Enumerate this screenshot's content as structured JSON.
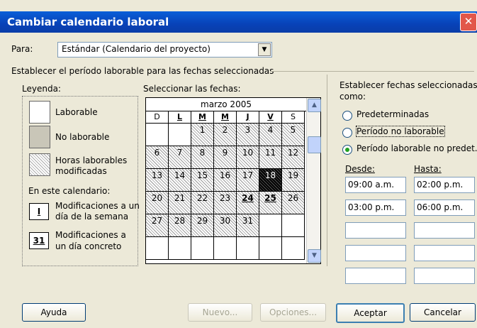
{
  "window": {
    "title": "Cambiar calendario laboral",
    "close_glyph": "✕"
  },
  "para": {
    "label": "Para:",
    "value": "Estándar (Calendario del proyecto)",
    "arrow": "▼"
  },
  "group_title": "Establecer el período laborable para las fechas seleccionadas",
  "legend": {
    "title": "Leyenda:",
    "items": [
      "Laborable",
      "No laborable",
      "Horas laborables",
      "modificadas"
    ],
    "subtitle": "En este calendario:",
    "icon1": "I",
    "icon1_label": [
      "Modificaciones a un",
      "día de la semana"
    ],
    "icon2": "31",
    "icon2_label": [
      "Modificaciones a",
      "un día concreto"
    ]
  },
  "calendar": {
    "label": "Seleccionar las fechas:",
    "month": "marzo 2005",
    "days": [
      "D",
      "L",
      "M",
      "M",
      "J",
      "V",
      "S"
    ],
    "weeks": [
      [
        "",
        "",
        "1",
        "2",
        "3",
        "4",
        "5"
      ],
      [
        "6",
        "7",
        "8",
        "9",
        "10",
        "11",
        "12"
      ],
      [
        "13",
        "14",
        "15",
        "16",
        "17",
        "18",
        "19"
      ],
      [
        "20",
        "21",
        "22",
        "23",
        "24",
        "25",
        "26"
      ],
      [
        "27",
        "28",
        "29",
        "30",
        "31",
        "",
        ""
      ],
      [
        "",
        "",
        "",
        "",
        "",
        "",
        ""
      ]
    ],
    "selected_date": "18",
    "modified_dates": [
      "24",
      "25"
    ]
  },
  "right": {
    "title_line1": "Establecer fechas seleccionadas",
    "title_line2": "como:",
    "options": [
      "Predeterminadas",
      "Período no laborable",
      "Período laborable no predet."
    ],
    "selected_option": 2,
    "desde": "Desde:",
    "hasta": "Hasta:",
    "rows": [
      [
        "09:00 a.m.",
        "02:00 p.m."
      ],
      [
        "03:00 p.m.",
        "06:00 p.m."
      ],
      [
        "",
        ""
      ],
      [
        "",
        ""
      ],
      [
        "",
        ""
      ]
    ]
  },
  "buttons": {
    "ayuda": "Ayuda",
    "nuevo": "Nuevo...",
    "opciones": "Opciones...",
    "aceptar": "Aceptar",
    "cancelar": "Cancelar"
  }
}
